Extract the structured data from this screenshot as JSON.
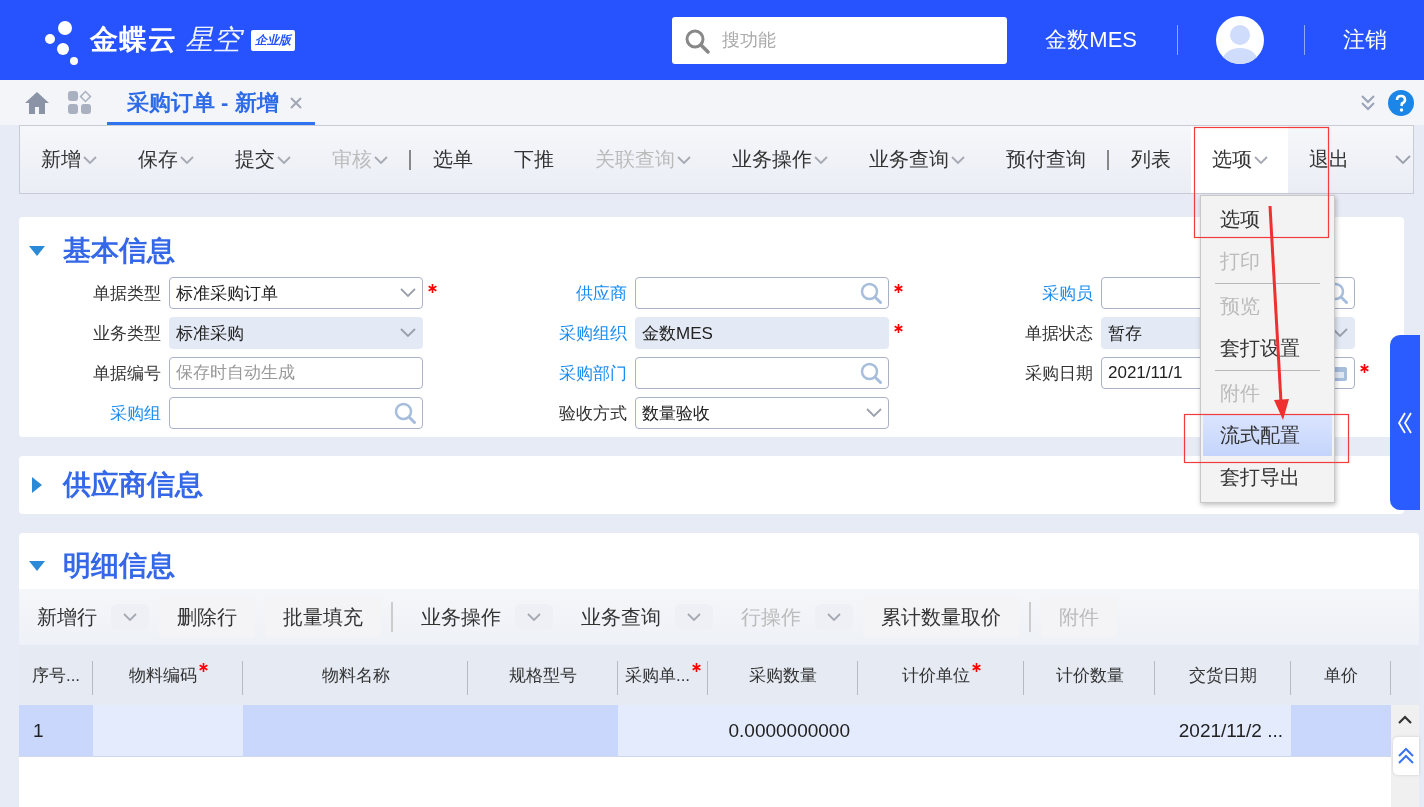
{
  "header": {
    "logo": {
      "brand": "金蝶云",
      "product": "星空",
      "edition": "企业版"
    },
    "search": {
      "placeholder": "搜功能"
    },
    "org": "金数MES",
    "logout": "注销"
  },
  "tabs": [
    {
      "label": "采购订单 - 新增",
      "selected": true
    }
  ],
  "toolbar": [
    {
      "kind": "button",
      "label": "新增",
      "caret": true,
      "disabled": false,
      "selected": false
    },
    {
      "kind": "button",
      "label": "保存",
      "caret": true,
      "disabled": false,
      "selected": false
    },
    {
      "kind": "button",
      "label": "提交",
      "caret": true,
      "disabled": false,
      "selected": false
    },
    {
      "kind": "button",
      "label": "审核",
      "caret": true,
      "disabled": true,
      "selected": false
    },
    {
      "kind": "separator"
    },
    {
      "kind": "button",
      "label": "选单",
      "caret": false,
      "disabled": false,
      "selected": false
    },
    {
      "kind": "button",
      "label": "下推",
      "caret": false,
      "disabled": false,
      "selected": false
    },
    {
      "kind": "button",
      "label": "关联查询",
      "caret": true,
      "disabled": true,
      "selected": false
    },
    {
      "kind": "button",
      "label": "业务操作",
      "caret": true,
      "disabled": false,
      "selected": false
    },
    {
      "kind": "button",
      "label": "业务查询",
      "caret": true,
      "disabled": false,
      "selected": false
    },
    {
      "kind": "button",
      "label": "预付查询",
      "caret": false,
      "disabled": false,
      "selected": false
    },
    {
      "kind": "separator"
    },
    {
      "kind": "button",
      "label": "列表",
      "caret": false,
      "disabled": false,
      "selected": false
    },
    {
      "kind": "button",
      "label": "选项",
      "caret": true,
      "disabled": false,
      "selected": true
    },
    {
      "kind": "button",
      "label": "退出",
      "caret": false,
      "disabled": false,
      "selected": false
    },
    {
      "kind": "more"
    }
  ],
  "options_menu": [
    {
      "kind": "item",
      "label": "选项",
      "disabled": false,
      "selected": false
    },
    {
      "kind": "item",
      "label": "打印",
      "disabled": true,
      "selected": false
    },
    {
      "kind": "separator"
    },
    {
      "kind": "item",
      "label": "预览",
      "disabled": true,
      "selected": false
    },
    {
      "kind": "item",
      "label": "套打设置",
      "disabled": false,
      "selected": false
    },
    {
      "kind": "separator"
    },
    {
      "kind": "item",
      "label": "附件",
      "disabled": true,
      "selected": false
    },
    {
      "kind": "item",
      "label": "流式配置",
      "disabled": false,
      "selected": true
    },
    {
      "kind": "item",
      "label": "套打导出",
      "disabled": false,
      "selected": false
    }
  ],
  "basic_info": {
    "title": "基本信息",
    "expanded": true,
    "columns": [
      [
        {
          "label": "单据类型",
          "link": false,
          "kind": "select",
          "value": "标准采购订单",
          "required": true,
          "readonly": false
        },
        {
          "label": "业务类型",
          "link": false,
          "kind": "select",
          "value": "标准采购",
          "required": false,
          "readonly": true
        },
        {
          "label": "单据编号",
          "link": false,
          "kind": "text",
          "placeholder": "保存时自动生成",
          "required": false,
          "readonly": false
        },
        {
          "label": "采购组",
          "link": true,
          "kind": "lookup",
          "required": false,
          "readonly": false
        }
      ],
      [
        {
          "label": "供应商",
          "link": true,
          "kind": "lookup",
          "required": true,
          "readonly": false
        },
        {
          "label": "采购组织",
          "link": true,
          "kind": "text",
          "value": "金数MES",
          "required": true,
          "readonly": true
        },
        {
          "label": "采购部门",
          "link": true,
          "kind": "lookup",
          "required": false,
          "readonly": false
        },
        {
          "label": "验收方式",
          "link": false,
          "kind": "select",
          "value": "数量验收",
          "required": false,
          "readonly": false
        }
      ],
      [
        {
          "label": "采购员",
          "link": true,
          "kind": "lookup",
          "required": false,
          "readonly": false
        },
        {
          "label": "单据状态",
          "link": false,
          "kind": "select",
          "value": "暂存",
          "required": false,
          "readonly": true
        },
        {
          "label": "采购日期",
          "link": false,
          "kind": "date",
          "value": "2021/11/1",
          "required": true,
          "readonly": false
        }
      ]
    ]
  },
  "supplier_info": {
    "title": "供应商信息",
    "expanded": false
  },
  "detail_info": {
    "title": "明细信息",
    "expanded": true,
    "toolbar": [
      {
        "kind": "split",
        "label": "新增行",
        "disabled": false
      },
      {
        "kind": "button",
        "label": "删除行",
        "disabled": false
      },
      {
        "kind": "button",
        "label": "批量填充",
        "disabled": false
      },
      {
        "kind": "separator"
      },
      {
        "kind": "split",
        "label": "业务操作",
        "disabled": false
      },
      {
        "kind": "split",
        "label": "业务查询",
        "disabled": false
      },
      {
        "kind": "split",
        "label": "行操作",
        "disabled": true
      },
      {
        "kind": "button",
        "label": "累计数量取价",
        "disabled": false
      },
      {
        "kind": "separator"
      },
      {
        "kind": "button",
        "label": "附件",
        "disabled": true
      }
    ],
    "table": {
      "columns": [
        {
          "label": "序号...",
          "required": false,
          "locked": true
        },
        {
          "label": "物料编码",
          "required": true,
          "locked": false
        },
        {
          "label": "物料名称",
          "required": false,
          "locked": true
        },
        {
          "label": "规格型号",
          "required": false,
          "locked": true
        },
        {
          "label": "采购单...",
          "required": true,
          "locked": false
        },
        {
          "label": "采购数量",
          "required": false,
          "locked": false
        },
        {
          "label": "计价单位",
          "required": true,
          "locked": false
        },
        {
          "label": "计价数量",
          "required": false,
          "locked": false
        },
        {
          "label": "交货日期",
          "required": false,
          "locked": false
        },
        {
          "label": "单价",
          "required": false,
          "locked": true
        }
      ],
      "rows": [
        {
          "selected": true,
          "cells": [
            "1",
            null,
            null,
            null,
            null,
            "0.0000000000",
            null,
            null,
            "2021/11/2 ...",
            null
          ]
        }
      ]
    }
  }
}
